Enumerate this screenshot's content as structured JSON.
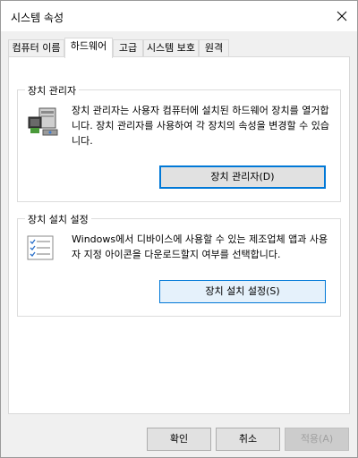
{
  "window": {
    "title": "시스템 속성"
  },
  "tabs": [
    {
      "label": "컴퓨터 이름"
    },
    {
      "label": "하드웨어"
    },
    {
      "label": "고급"
    },
    {
      "label": "시스템 보호"
    },
    {
      "label": "원격"
    }
  ],
  "device_manager": {
    "title": "장치 관리자",
    "description": "장치 관리자는 사용자 컴퓨터에 설치된 하드웨어 장치를 열거합니다. 장치 관리자를 사용하여 각 장치의 속성을 변경할 수 있습니다.",
    "button_label": "장치 관리자(D)",
    "icon": "device-manager-icon"
  },
  "device_install": {
    "title": "장치 설치 설정",
    "description": "Windows에서 디바이스에 사용할 수 있는 제조업체 앱과 사용자 지정 아이콘을 다운로드할지 여부를 선택합니다.",
    "button_label": "장치 설치 설정(S)",
    "icon": "checklist-icon"
  },
  "footer": {
    "ok_label": "확인",
    "cancel_label": "취소",
    "apply_label": "적용(A)"
  },
  "colors": {
    "accent": "#0078d7",
    "face": "#f0f0f0",
    "button": "#e1e1e1"
  }
}
